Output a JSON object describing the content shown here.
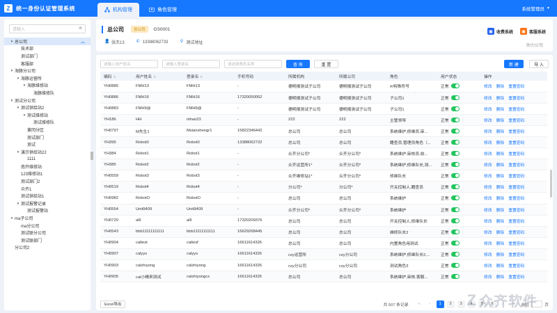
{
  "app": {
    "title": "统一身份认证管理系统",
    "logo_letter": "Z"
  },
  "tabs": [
    {
      "label": "机构管理",
      "active": true
    },
    {
      "label": "角色管理",
      "active": false
    }
  ],
  "user": {
    "name": "系统管理员"
  },
  "sidebar": {
    "search_placeholder": "请输入",
    "tree": [
      {
        "label": "总公司",
        "level": 0,
        "expanded": true,
        "selected": true
      },
      {
        "label": "技术部",
        "level": 1
      },
      {
        "label": "测试部门",
        "level": 1
      },
      {
        "label": "客服部",
        "level": 1
      },
      {
        "label": "海豚分公司",
        "level": 0,
        "expanded": true
      },
      {
        "label": "海豚运营所",
        "level": 1,
        "expanded": true
      },
      {
        "label": "海豚维修站",
        "level": 2,
        "expanded": true
      },
      {
        "label": "海豚维修队",
        "level": 3
      },
      {
        "label": "测试分公司",
        "level": 0,
        "expanded": true
      },
      {
        "label": "测试供给站2",
        "level": 1,
        "expanded": true
      },
      {
        "label": "测试维修站",
        "level": 2,
        "expanded": true
      },
      {
        "label": "测试维修队",
        "level": 3
      },
      {
        "label": "黄冈分区",
        "level": 2
      },
      {
        "label": "测试部门",
        "level": 2
      },
      {
        "label": "测试",
        "level": 2
      },
      {
        "label": "演示供给站22",
        "level": 1,
        "expanded": true
      },
      {
        "label": "1111",
        "level": 2
      },
      {
        "label": "南开维修站",
        "level": 1
      },
      {
        "label": "123维修站1",
        "level": 1
      },
      {
        "label": "测试部门2",
        "level": 1
      },
      {
        "label": "众齐1",
        "level": 1
      },
      {
        "label": "测试供给站1",
        "level": 1
      },
      {
        "label": "测试报警记录",
        "level": 1,
        "expanded": true
      },
      {
        "label": "测试报警站",
        "level": 2
      },
      {
        "label": "ma子公司",
        "level": 0,
        "expanded": true
      },
      {
        "label": "ma分公司",
        "level": 1
      },
      {
        "label": "测试联分公司",
        "level": 1
      },
      {
        "label": "测试联部门",
        "level": 1
      },
      {
        "label": "分公司2",
        "level": 0
      }
    ]
  },
  "org": {
    "name": "总公司",
    "tag": "总公司",
    "code": "GS0001",
    "contact": "张杰13",
    "phone": "13388062733",
    "address": "测试地址",
    "tenant": "助力公司",
    "systems": [
      {
        "label": "收费系统",
        "color": "#2563eb"
      },
      {
        "label": "客服系统",
        "color": "#f97316"
      }
    ]
  },
  "filters": {
    "user_name_placeholder": "请输入用户姓名",
    "login_name_placeholder": "请输入登录名",
    "role_placeholder": "请选择角色名称",
    "query_label": "查 询",
    "reset_label": "重 置",
    "add_label": "新 建",
    "import_label": "导 入"
  },
  "table": {
    "columns": [
      "编码",
      "用户姓名",
      "登录名",
      "手机号码",
      "所属机构",
      "所属公司",
      "角色",
      "用户状态",
      "操作"
    ],
    "status_text": "正常",
    "ops": [
      "修改",
      "删除",
      "重置密码"
    ],
    "rows": [
      [
        "YH0885",
        "FMH13",
        "FMH13",
        "-",
        "德明报测试子公司",
        "德明报测试子公司",
        "#/特殊符号",
        "正常"
      ],
      [
        "YH0886",
        "FMH16",
        "FMH16",
        "17320050052",
        "德明报测试子公司",
        "德明报测试子公司",
        "子公司1",
        "正常"
      ],
      [
        "YH0883",
        "FMH9@",
        "FMH9@",
        "-",
        "德明报测试子公司",
        "德明报测试子公司",
        "子公司1",
        "正常"
      ],
      [
        "YH186",
        "HH",
        "nihao23",
        "-",
        "222",
        "222",
        "主管领导",
        "正常"
      ],
      [
        "YH0797",
        "M先生1",
        "Msianshengr1",
        "15822346442",
        "总公司",
        "总公司",
        "系统维护,修维员,审...",
        "正常"
      ],
      [
        "YH395",
        "Robot0",
        "Robot0",
        "13388062732",
        "总公司",
        "总公司",
        "籍查员,管理员角色（...",
        "正常"
      ],
      [
        "YH384",
        "Robot1",
        "Robot1",
        "-",
        "众齐分公司*",
        "众齐分公司*",
        "系统维护,审核员,收...",
        "正常"
      ],
      [
        "YH385",
        "Robot2",
        "Robot2",
        "-",
        "众齐运营所1*",
        "众齐分公司*",
        "系统维护,修维队长,测...",
        "正常"
      ],
      [
        "YH0559",
        "Robot3",
        "Robot3",
        "-",
        "众齐维修站1*",
        "众齐分公司*",
        "修维队长",
        "正常"
      ],
      [
        "YH0519",
        "Robot4",
        "Robot4",
        "-",
        "分公司*",
        "分公司*",
        "开关控制人,籍查员",
        "正常"
      ],
      [
        "YH0982",
        "RobotO",
        "RobotO",
        "-",
        "总公司",
        "总公司",
        "系统维护",
        "正常"
      ],
      [
        "YH0554",
        "Unit9409",
        "Unit9409",
        "-",
        "众齐分公司*",
        "众齐分公司*",
        "系统维护",
        "正常"
      ],
      [
        "YH0720",
        "alll",
        "alll",
        "17320209376",
        "总公司",
        "总公司",
        "开关控制人,修维队长",
        "正常"
      ],
      [
        "YH0543",
        "bbb11111111111",
        "bbb11111111111",
        "16629268445",
        "总公司",
        "总公司",
        "维修队长2",
        "正常"
      ],
      [
        "YH0904",
        "caltest",
        "caltesf",
        "16611614326",
        "总公司",
        "总公司",
        "内置角色用测试",
        "正常"
      ],
      [
        "YH0907",
        "calyys",
        "calyys",
        "16611614326",
        "czy运营所",
        "czy分公司",
        "系统维护,修维队长2,...",
        "正常"
      ],
      [
        "YH0903",
        "calzhiyong",
        "calzhiyong",
        "16611614326",
        "czy分公司",
        "czy分公司",
        "测试角色3",
        "正常"
      ],
      [
        "YH0905",
        "cal小精来测试",
        "calzhiyongcx",
        "16611614326",
        "总公司",
        "总公司",
        "系统维护,审核,客服...",
        "正常"
      ]
    ]
  },
  "footer": {
    "export_label": "Excel导出",
    "total_text": "共 507 条记录",
    "pages": [
      "1",
      "2",
      "3",
      "4",
      "5",
      "6"
    ],
    "current_page": "1",
    "goto_label": "前往",
    "page_unit": "页"
  },
  "watermark": {
    "mark": "Z",
    "text": "众齐软件"
  }
}
